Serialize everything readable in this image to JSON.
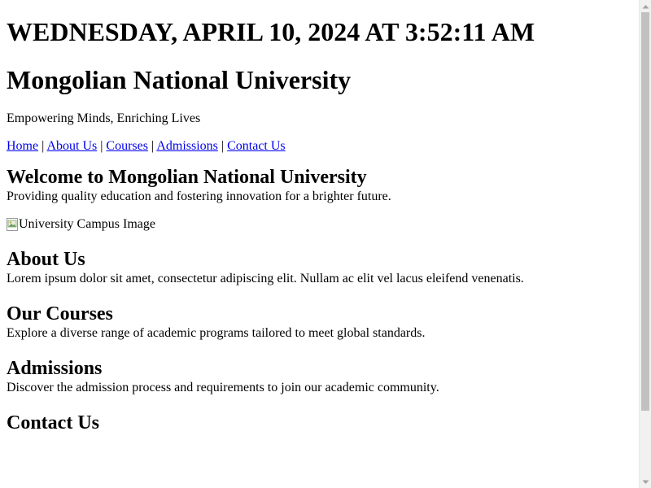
{
  "header": {
    "datetime": "WEDNESDAY, APRIL 10, 2024 AT 3:52:11 AM",
    "title": "Mongolian National University",
    "tagline": "Empowering Minds, Enriching Lives"
  },
  "nav": {
    "items": [
      {
        "label": "Home"
      },
      {
        "label": "About Us"
      },
      {
        "label": "Courses"
      },
      {
        "label": "Admissions"
      },
      {
        "label": "Contact Us"
      }
    ],
    "separator": "|"
  },
  "welcome": {
    "heading": "Welcome to Mongolian National University",
    "text": "Providing quality education and fostering innovation for a brighter future.",
    "image_alt": "University Campus Image"
  },
  "about": {
    "heading": "About Us",
    "text": "Lorem ipsum dolor sit amet, consectetur adipiscing elit. Nullam ac elit vel lacus eleifend venenatis."
  },
  "courses": {
    "heading": "Our Courses",
    "text": "Explore a diverse range of academic programs tailored to meet global standards."
  },
  "admissions": {
    "heading": "Admissions",
    "text": "Discover the admission process and requirements to join our academic community."
  },
  "contact": {
    "heading": "Contact Us"
  },
  "colors": {
    "link": "#0000ee",
    "text": "#000000",
    "background": "#ffffff",
    "scrollbar_track": "#f1f1f1",
    "scrollbar_thumb": "#c1c1c1"
  },
  "icons": {
    "broken_image": "broken-image-icon",
    "scroll_up": "triangle-up-icon",
    "scroll_down": "triangle-down-icon"
  }
}
